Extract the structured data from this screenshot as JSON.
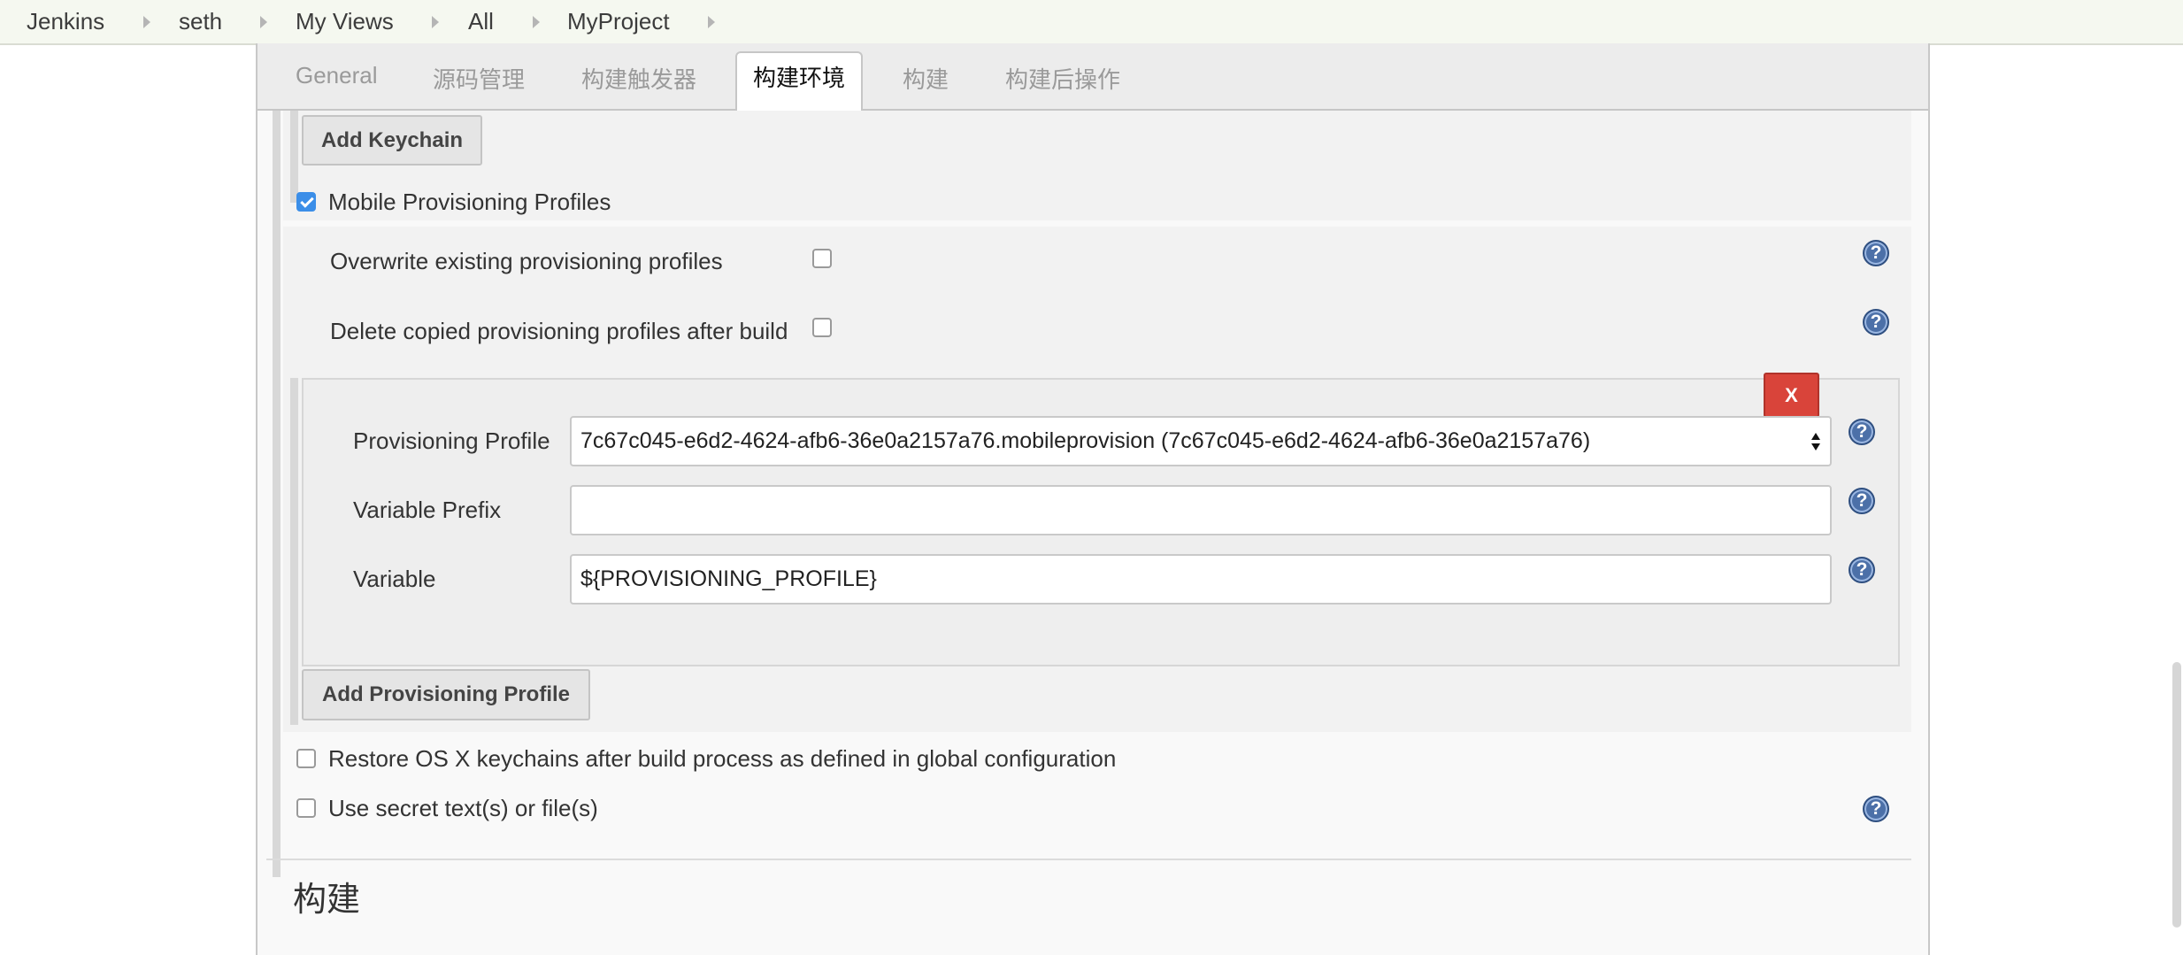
{
  "breadcrumb": [
    "Jenkins",
    "seth",
    "My Views",
    "All",
    "MyProject"
  ],
  "tabs": [
    "General",
    "源码管理",
    "构建触发器",
    "构建环境",
    "构建",
    "构建后操作"
  ],
  "active_tab": "构建环境",
  "add_keychain_label": "Add Keychain",
  "mobile_provisioning": {
    "label": "Mobile Provisioning Profiles",
    "checked": true,
    "overwrite_label": "Overwrite existing provisioning profiles",
    "overwrite_checked": false,
    "delete_label": "Delete copied provisioning profiles after build",
    "delete_checked": false,
    "delete_button_label": "X",
    "profile_label": "Provisioning Profile",
    "profile_value": "7c67c045-e6d2-4624-afb6-36e0a2157a76.mobileprovision (7c67c045-e6d2-4624-afb6-36e0a2157a76)",
    "prefix_label": "Variable Prefix",
    "prefix_value": "",
    "variable_label": "Variable",
    "variable_value": "${PROVISIONING_PROFILE}",
    "add_profile_label": "Add Provisioning Profile"
  },
  "restore_keychains_label": "Restore OS X keychains after build process as defined in global configuration",
  "restore_keychains_checked": false,
  "secret_label": "Use secret text(s) or file(s)",
  "secret_checked": false,
  "section_heading": "构建",
  "help_glyph": "?",
  "colors": {
    "checkbox_checked": "#3b8ee8",
    "delete_button": "#d9443a",
    "help_icon": "#4c70a8"
  }
}
